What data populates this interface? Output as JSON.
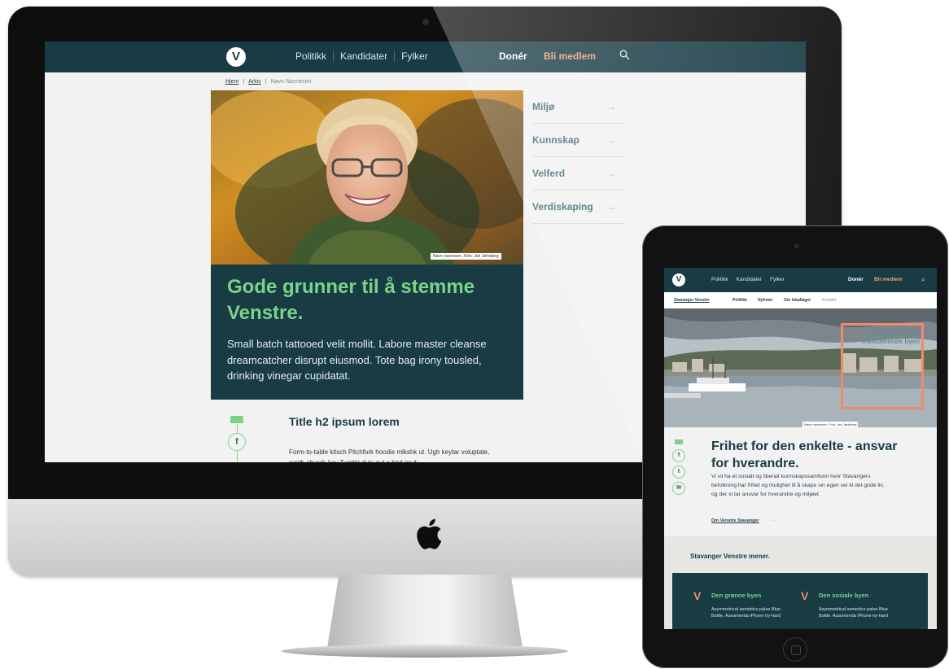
{
  "desktop": {
    "nav": {
      "logo": "V",
      "items": [
        "Politikk",
        "Kandidater",
        "Fylker"
      ],
      "donate": "Donér",
      "join": "Bli medlem"
    },
    "breadcrumb": [
      "Hjem",
      "Arkiv",
      "Navn Navnesen"
    ],
    "hero_caption": "Navn navnesen. Foto: Jarl Jørlsberg",
    "title": "Gode grunner til å stemme Venstre.",
    "lead": "Small batch tattooed velit mollit. Labore master cleanse dreamcatcher disrupt eiusmod. Tote bag irony tousled, drinking vinegar cupidatat.",
    "side_menu": [
      "Miljø",
      "Kunnskap",
      "Velferd",
      "Verdiskaping"
    ],
    "arrow": "→",
    "share_icon": "f",
    "h2": "Title h2 ipsum lorem",
    "body": "Form-to-table kitsch Pitchfork hoodie mlkshk ut. Ugh keytar voluptate, synth church-key Tumblr duis put a bird on it."
  },
  "tablet": {
    "nav": {
      "logo": "V",
      "items": [
        "Politikk",
        "Kandidater",
        "Fylker"
      ],
      "donate": "Donér",
      "join": "Bli medlem",
      "search_icon": "⌕"
    },
    "subnav": [
      "Stavanger Venstre",
      "Politikk",
      "Nyheter",
      "Om lokallaget",
      "Kontakt"
    ],
    "hero_box": "Stavanger - Den inkluderende byen",
    "hero_caption": "Navn navnesen. Foto: Jarl Jørlsberg",
    "share_icons": [
      "f",
      "t",
      "✉"
    ],
    "title": "Frihet for den enkelte - ansvar for hverandre.",
    "text": "Vi vil ha et sosialt og liberalt kunnskapssamfunn hvor Stavangers befolkning har frihet og mulighet til å skape sin egen vei til det gode liv, og der vi tar ansvar for hverandre og miljøet.",
    "link": "Om Venstre Stavanger",
    "link_arrow": "→",
    "opinion_heading": "Stavanger Venstre mener.",
    "columns": [
      {
        "mark": "V",
        "title": "Den grønne byen",
        "text": "Asymmetrical semiotics paleo Blue Bottle. Assumenda iPhone try-hard"
      },
      {
        "mark": "V",
        "title": "Den sosiale byen",
        "text": "Asymmetrical semiotics paleo Blue Bottle. Assumenda iPhone try-hard"
      }
    ]
  },
  "colors": {
    "nav_bg": "#183b44",
    "accent_green": "#7bd389",
    "accent_orange": "#ef8c67"
  }
}
